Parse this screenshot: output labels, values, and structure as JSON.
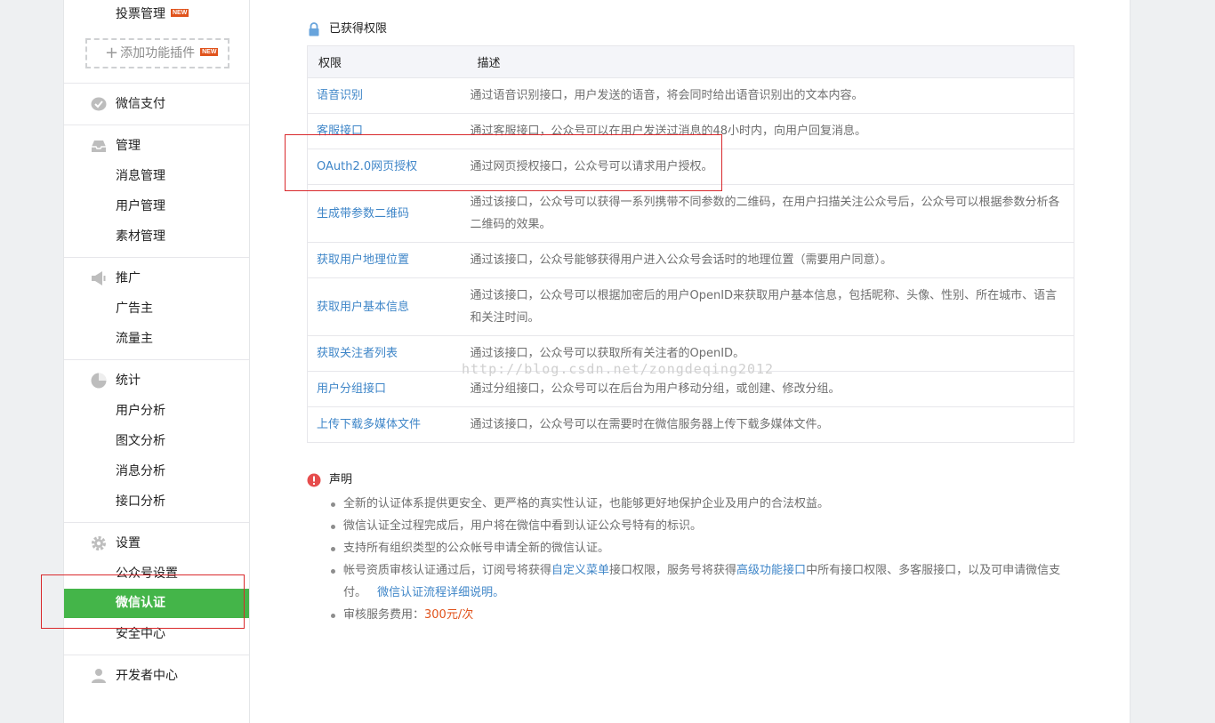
{
  "sidebar": {
    "vote_mgmt": "投票管理",
    "new_badge": "NEW",
    "add_plugin": "添加功能插件",
    "wechat_pay": "微信支付",
    "manage": {
      "label": "管理",
      "items": [
        "消息管理",
        "用户管理",
        "素材管理"
      ]
    },
    "promote": {
      "label": "推广",
      "items": [
        "广告主",
        "流量主"
      ]
    },
    "stats": {
      "label": "统计",
      "items": [
        "用户分析",
        "图文分析",
        "消息分析",
        "接口分析"
      ]
    },
    "settings": {
      "label": "设置",
      "items": [
        "公众号设置",
        "微信认证",
        "安全中心"
      ]
    },
    "developer": "开发者中心"
  },
  "main": {
    "permissions_title": "已获得权限",
    "table": {
      "headers": [
        "权限",
        "描述"
      ],
      "rows": [
        {
          "name": "语音识别",
          "desc": "通过语音识别接口，用户发送的语音，将会同时给出语音识别出的文本内容。"
        },
        {
          "name": "客服接口",
          "desc": "通过客服接口，公众号可以在用户发送过消息的48小时内，向用户回复消息。"
        },
        {
          "name": "OAuth2.0网页授权",
          "desc": "通过网页授权接口，公众号可以请求用户授权。"
        },
        {
          "name": "生成带参数二维码",
          "desc": "通过该接口，公众号可以获得一系列携带不同参数的二维码，在用户扫描关注公众号后，公众号可以根据参数分析各二维码的效果。"
        },
        {
          "name": "获取用户地理位置",
          "desc": "通过该接口，公众号能够获得用户进入公众号会话时的地理位置（需要用户同意）。"
        },
        {
          "name": "获取用户基本信息",
          "desc": "通过该接口，公众号可以根据加密后的用户OpenID来获取用户基本信息，包括昵称、头像、性别、所在城市、语言和关注时间。"
        },
        {
          "name": "获取关注者列表",
          "desc": "通过该接口，公众号可以获取所有关注者的OpenID。"
        },
        {
          "name": "用户分组接口",
          "desc": "通过分组接口，公众号可以在后台为用户移动分组，或创建、修改分组。"
        },
        {
          "name": "上传下载多媒体文件",
          "desc": "通过该接口，公众号可以在需要时在微信服务器上传下载多媒体文件。"
        }
      ]
    },
    "watermark": "http://blog.csdn.net/zongdeqing2012",
    "statement_title": "声明",
    "notes": {
      "n1": "全新的认证体系提供更安全、更严格的真实性认证，也能够更好地保护企业及用户的合法权益。",
      "n2": "微信认证全过程完成后，用户将在微信中看到认证公众号特有的标识。",
      "n3": "支持所有组织类型的公众帐号申请全新的微信认证。",
      "n4_a": "帐号资质审核认证通过后，订阅号将获得",
      "n4_link1": "自定义菜单",
      "n4_b": "接口权限，服务号将获得",
      "n4_link2": "高级功能接口",
      "n4_c": "中所有接口权限、多客服接口，以及可申请微信支付。",
      "n4_link3": "微信认证流程详细说明。",
      "n5_label": "审核服务费用：",
      "n5_price": "300元/次"
    }
  },
  "colors": {
    "accent_green": "#44b549",
    "link_blue": "#3f86c8",
    "highlight_red": "#d9292c",
    "price_orange": "#e0531c"
  },
  "icons": {
    "pay": "wechat-pay-icon",
    "manage": "inbox-icon",
    "promote": "megaphone-icon",
    "stats": "pie-chart-icon",
    "settings": "gear-icon",
    "developer": "person-icon",
    "lock": "lock-icon",
    "warning": "exclamation-icon"
  }
}
